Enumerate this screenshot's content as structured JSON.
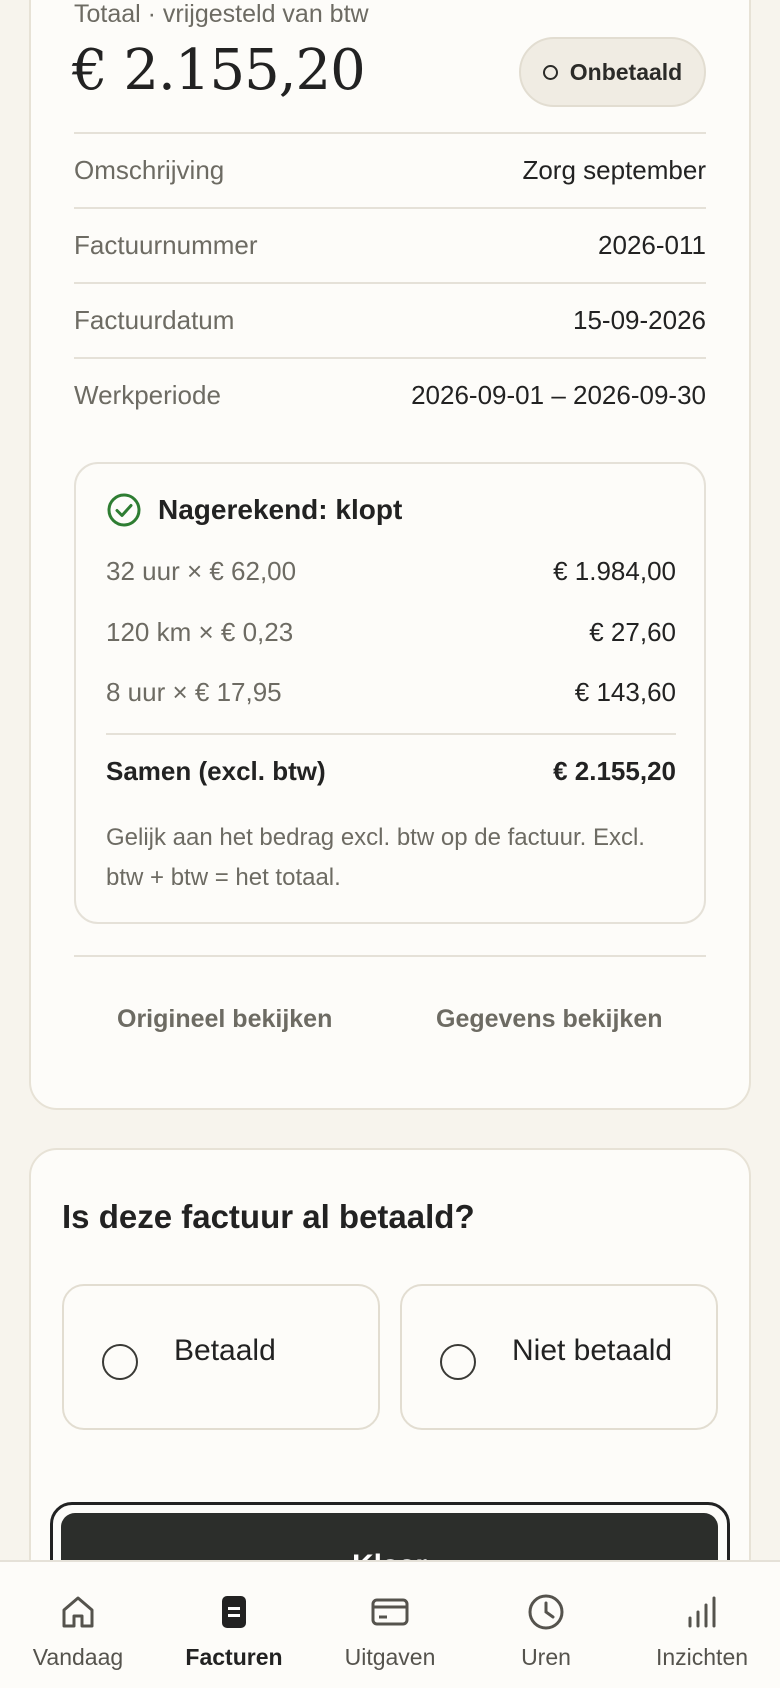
{
  "invoice": {
    "subtitle": "Totaal · vrijgesteld van btw",
    "total": "€ 2.155,20",
    "status": "Onbetaald",
    "rows": [
      {
        "label": "Omschrijving",
        "value": "Zorg september"
      },
      {
        "label": "Factuurnummer",
        "value": "2026-011"
      },
      {
        "label": "Factuurdatum",
        "value": "15-09-2026"
      },
      {
        "label": "Werkperiode",
        "value": "2026-09-01 – 2026-09-30"
      }
    ]
  },
  "check": {
    "title": "Nagerekend: klopt",
    "lines": [
      {
        "label": "32 uur × € 62,00",
        "value": "€ 1.984,00"
      },
      {
        "label": "120 km × € 0,23",
        "value": "€ 27,60"
      },
      {
        "label": "8 uur × € 17,95",
        "value": "€ 143,60"
      }
    ],
    "sum_label": "Samen (excl. btw)",
    "sum_value": "€ 2.155,20",
    "note": "Gelijk aan het bedrag excl. btw op de factuur. Excl. btw + btw = het totaal."
  },
  "links": {
    "original": "Origineel bekijken",
    "details": "Gegevens bekijken"
  },
  "payment": {
    "question": "Is deze factuur al betaald?",
    "paid": "Betaald",
    "unpaid": "Niet betaald",
    "done": "Klaar"
  },
  "tabs": [
    {
      "label": "Vandaag",
      "icon": "home-icon"
    },
    {
      "label": "Facturen",
      "icon": "invoice-icon",
      "active": true
    },
    {
      "label": "Uitgaven",
      "icon": "card-icon"
    },
    {
      "label": "Uren",
      "icon": "clock-icon"
    },
    {
      "label": "Inzichten",
      "icon": "bar-chart-icon"
    }
  ],
  "colors": {
    "accent_dark": "#2c2e2b",
    "success": "#2e7d32",
    "background": "#f7f4ed"
  }
}
